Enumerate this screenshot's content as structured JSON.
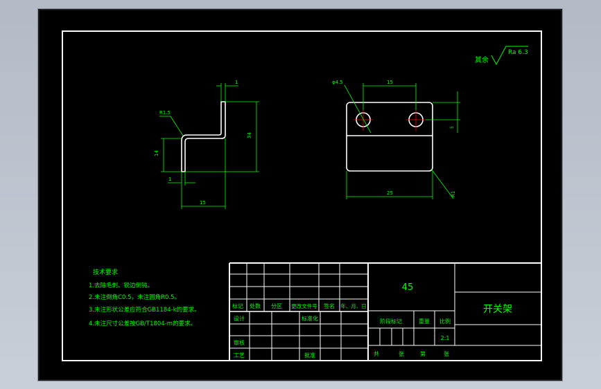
{
  "roughness": {
    "label": "其余",
    "value": "Ra 6.3"
  },
  "side_view": {
    "dims": {
      "radius": "R1.5",
      "thickness": "1",
      "total_height": "34",
      "base_height": "14",
      "base_width": "15",
      "left_offset": "1"
    }
  },
  "front_view": {
    "dims": {
      "hole_dia": "φ4.5",
      "hole_spacing": "15",
      "width": "25",
      "corner_radius": "R1",
      "hole_offset": "5"
    }
  },
  "tech_requirements": {
    "title": "技术要求",
    "items": [
      "1.去除毛刺、锐边倒钝。",
      "2.未注倒角C0.5，未注圆角R0.5。",
      "3.未注形状公差应符合GB1184-k的要求。",
      "4.未注尺寸公差按GB/T1804-m的要求。"
    ]
  },
  "title_block": {
    "material": "45",
    "part_name": "开关架",
    "revision_headers": [
      "标记",
      "处数",
      "分区",
      "更改文件号",
      "签名",
      "年、月、日"
    ],
    "row_design": "设计",
    "row_standardize": "标准化",
    "row_review": "审核",
    "row_process": "工艺",
    "row_approve": "批准",
    "stage_label": "阶段标记",
    "weight_label": "重量",
    "scale_label": "比例",
    "scale_value": "2:1",
    "sheet_total": "共",
    "sheet_unit1": "张",
    "sheet_of": "第",
    "sheet_unit2": "张"
  },
  "colors": {
    "background": "#000000",
    "outline": "#ffffff",
    "dimension": "#00ff00",
    "centerline": "#ff0000",
    "text": "#00ff00",
    "title_text": "#00ff00"
  }
}
